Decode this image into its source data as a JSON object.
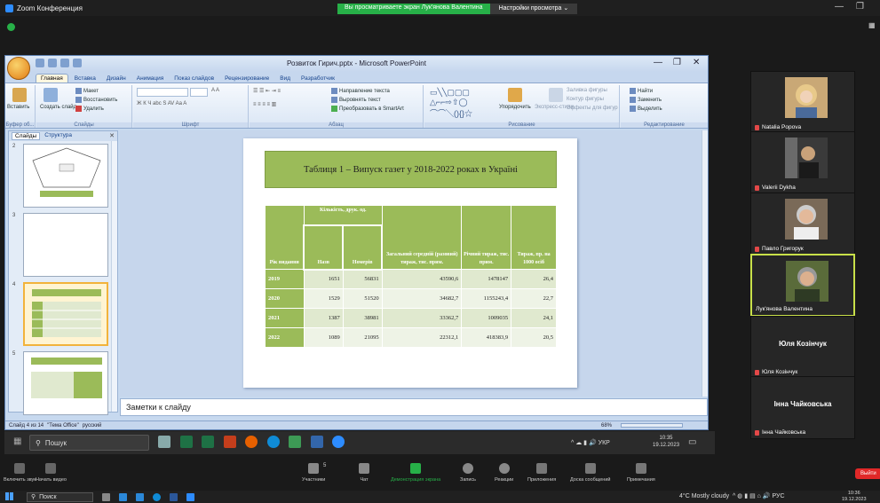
{
  "zoom": {
    "title": "Zoom Конференция",
    "share_banner": "Вы просматриваете экран Лук'янова Валентина",
    "view_options": "Настройки просмотра",
    "controls": [
      {
        "label": "Включить звук",
        "color": "#ddd"
      },
      {
        "label": "Начать видео",
        "color": "#ddd"
      },
      {
        "label": "Участники",
        "color": "#ddd"
      },
      {
        "label": "Чат",
        "color": "#ddd"
      },
      {
        "label": "Демонстрация экрана",
        "color": "#27b048"
      },
      {
        "label": "Запись",
        "color": "#ddd"
      },
      {
        "label": "Реакции",
        "color": "#ddd"
      },
      {
        "label": "Приложения",
        "color": "#ddd"
      },
      {
        "label": "Доска сообщений",
        "color": "#ddd"
      },
      {
        "label": "Примечания",
        "color": "#ddd"
      }
    ],
    "participants_count": "5",
    "leave": "Выйти"
  },
  "ppt": {
    "title": "Розвиток Гирич.pptx - Microsoft PowerPoint",
    "tabs": [
      "Главная",
      "Вставка",
      "Дизайн",
      "Анимация",
      "Показ слайдов",
      "Рецензирование",
      "Вид",
      "Разработчик"
    ],
    "ribbon": {
      "paste": "Вставить",
      "layout": "Макет",
      "restore": "Восстановить",
      "create": "Создать слайд",
      "delete": "Удалить",
      "align_text": "Направление текста",
      "align": "Выровнять текст",
      "smartart": "Преобразовать в SmartArt",
      "arrange": "Упорядочить",
      "quick_styles": "Экспресс-стили",
      "fill": "Заливка фигуры",
      "outline": "Контур фигуры",
      "effects": "Эффекты для фигур",
      "find": "Найти",
      "replace": "Заменить",
      "select": "Выделить",
      "groups": [
        "Буфер об...",
        "Слайды",
        "Шрифт",
        "Абзац",
        "Рисование",
        "Редактирование"
      ]
    },
    "pane_tabs": [
      "Слайды",
      "Структура"
    ],
    "thumb_nums": [
      "2",
      "3",
      "4",
      "5"
    ],
    "notes": "Заметки к слайду",
    "status": [
      "Слайд 4 из 14",
      "\"Тема Office\"",
      "русский"
    ],
    "zoom_pct": "68%"
  },
  "slide": {
    "title": "Таблиця 1 – Випуск газет у 2018-2022 роках в Україні",
    "headers": {
      "year": "Рік видання",
      "count_group": "Кількість, друк. од.",
      "names": "Назв",
      "issues": "Номерів",
      "avg": "Загальний середній (разовий) тираж, тис. прим.",
      "annual": "Річний тираж, тис. прим.",
      "per1000": "Тираж, пр. на 1000 осіб"
    },
    "rows": [
      [
        "2019",
        "1651",
        "56831",
        "43590,6",
        "1478147",
        "26,4"
      ],
      [
        "2020",
        "1529",
        "51520",
        "34682,7",
        "1155243,4",
        "22,7"
      ],
      [
        "2021",
        "1387",
        "38981",
        "33362,7",
        "1009035",
        "24,1"
      ],
      [
        "2022",
        "1089",
        "21095",
        "22312,1",
        "418383,9",
        "20,5"
      ]
    ]
  },
  "participants": [
    {
      "name": "Natalia Popova",
      "photo": "#c9a876",
      "hair": "#e8c98a"
    },
    {
      "name": "Valerii Dykha",
      "photo": "#3a3a3a",
      "hair": "#222"
    },
    {
      "name": "Павло Григорук",
      "photo": "#7a6a58",
      "hair": "#ccc"
    },
    {
      "name": "Лук'янова Валентина",
      "photo": "#5a6b3a",
      "hair": "#999"
    },
    {
      "name": "Юля Козінчук",
      "photo": "",
      "hair": ""
    },
    {
      "name": "Інна Чайковська",
      "photo": "",
      "hair": ""
    }
  ],
  "inner_taskbar": {
    "search": "Пошук",
    "lang": "УКР",
    "time": "10:35",
    "date": "19.12.2023"
  },
  "outer_taskbar": {
    "search": "Поиск",
    "weather": "4°C Mostly cloudy",
    "lang": "РУС",
    "time": "10:36",
    "date": "19.12.2023"
  }
}
